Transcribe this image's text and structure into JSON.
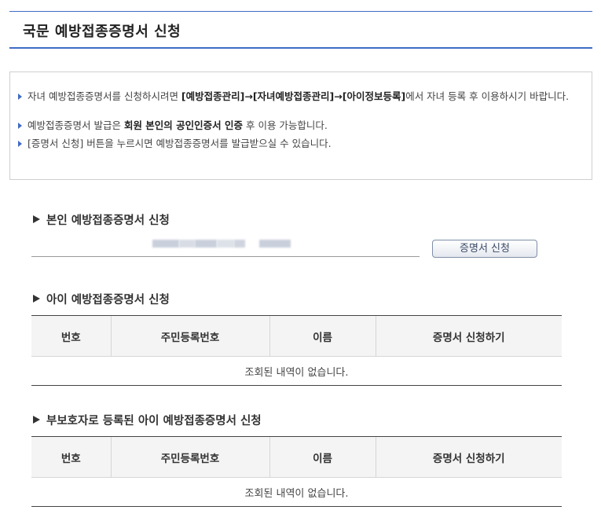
{
  "header": {
    "title": "국문 예방접종증명서 신청"
  },
  "notice": {
    "line1_pre": "자녀 예방접종증명서를 신청하시려면 ",
    "line1_bold1": "[예방접종관리]",
    "line1_arrow1": "→",
    "line1_bold2": "[자녀예방접종관리]",
    "line1_arrow2": "→",
    "line1_bold3": "[아이정보등록]",
    "line1_post": "에서 자녀 등록 후 이용하시기 바랍니다.",
    "line2_pre": "예방접종증명서 발급은 ",
    "line2_bold": "회원 본인의 공인인증서 인증",
    "line2_post": " 후 이용 가능합니다.",
    "line3": "[증명서 신청] 버튼을 누르시면 예방접종증명서를 발급받으실 수 있습니다."
  },
  "self_section": {
    "title": "본인 예방접종증명서 신청",
    "button_label": "증명서 신청"
  },
  "child_section": {
    "title": "아이 예방접종증명서 신청",
    "columns": [
      "번호",
      "주민등록번호",
      "이름",
      "증명서 신청하기"
    ],
    "empty_message": "조회된 내역이 없습니다."
  },
  "guardian_section": {
    "title": "부보호자로 등록된 아이 예방접종증명서 신청",
    "columns": [
      "번호",
      "주민등록번호",
      "이름",
      "증명서 신청하기"
    ],
    "empty_message": "조회된 내역이 없습니다."
  },
  "colors": {
    "accent": "#3f6cc5",
    "table_border": "#444444",
    "header_bg": "#f4f4f4"
  }
}
